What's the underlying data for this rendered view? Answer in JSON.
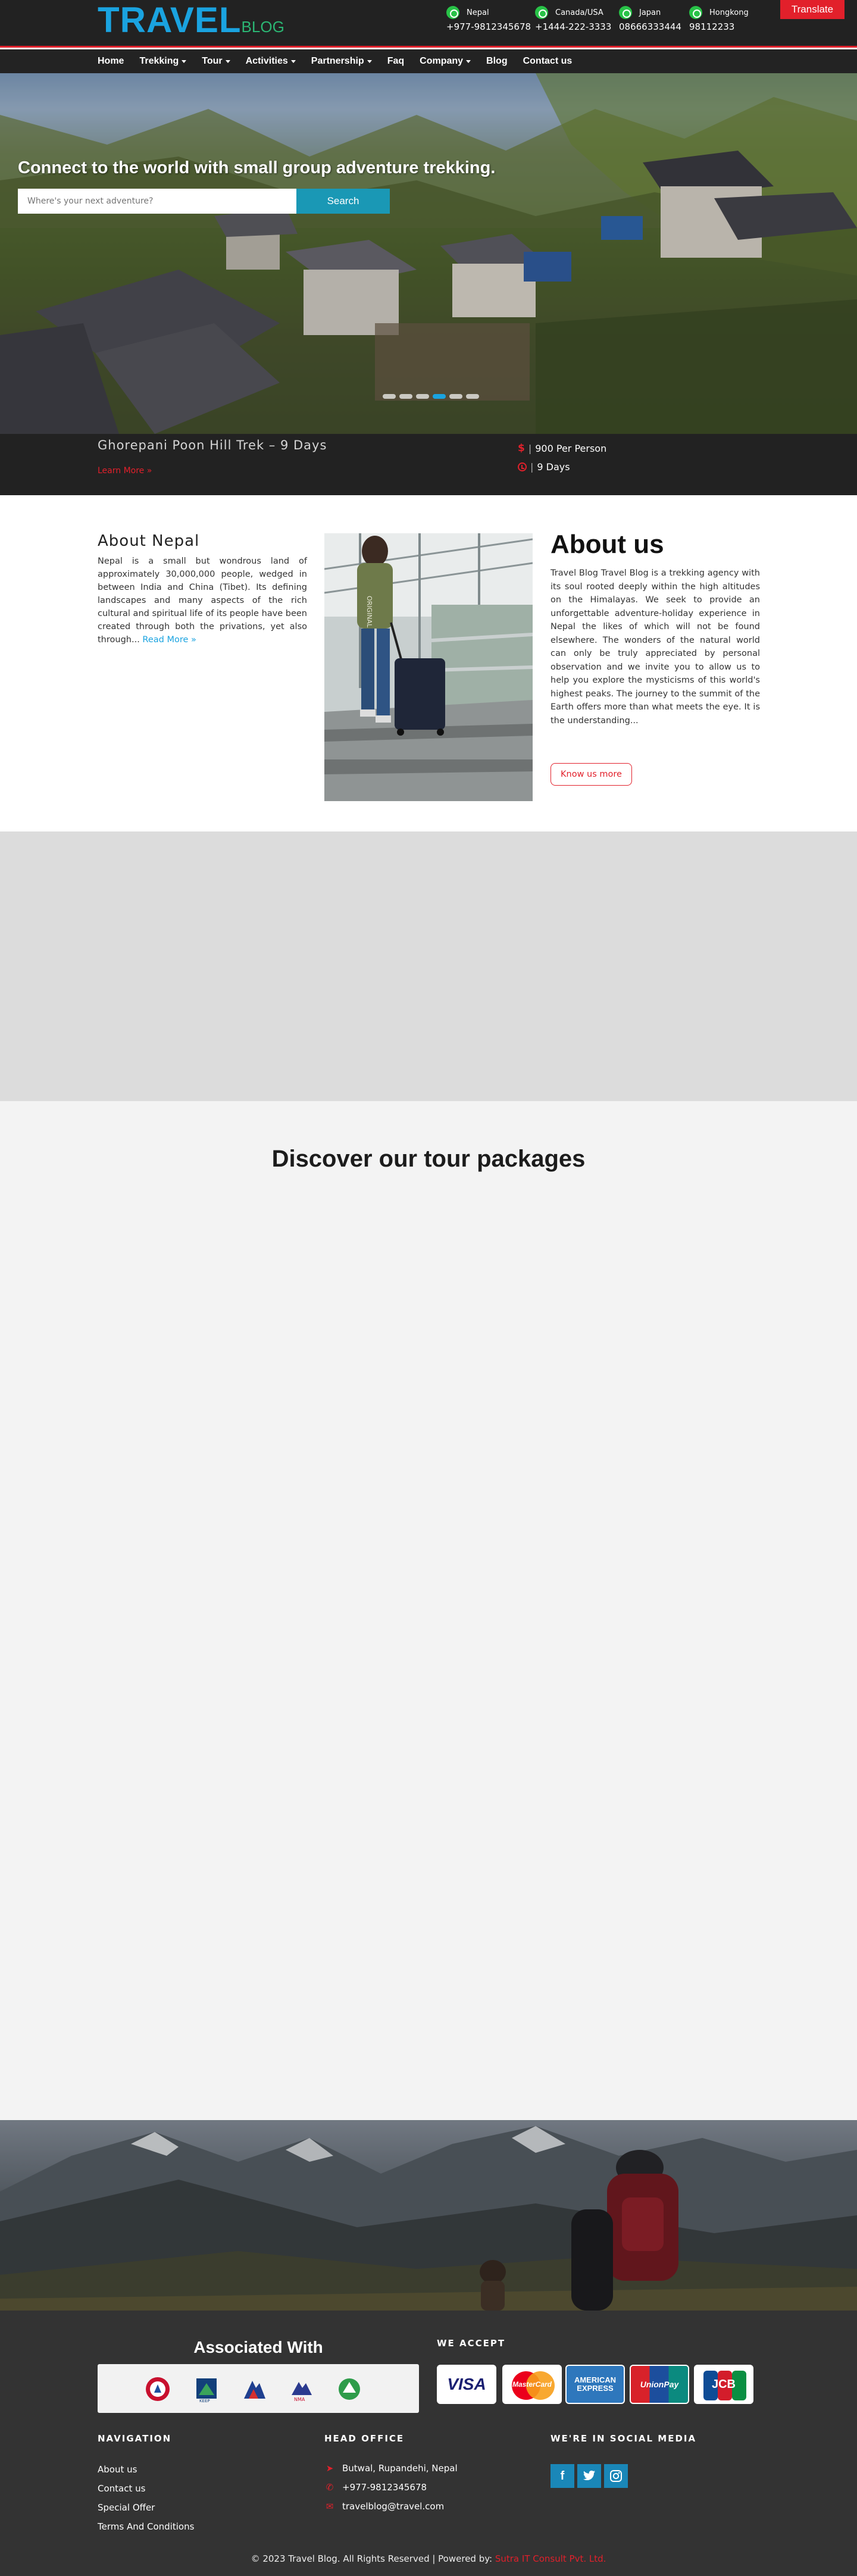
{
  "brand": {
    "logo_main": "TRAVEL",
    "logo_sub": "BLOG"
  },
  "contacts": [
    {
      "country": "Nepal",
      "number": "+977-9812345678"
    },
    {
      "country": "Canada/USA",
      "number": "+1444-222-3333"
    },
    {
      "country": "Japan",
      "number": "08666333444"
    },
    {
      "country": "Hongkong",
      "number": "98112233"
    }
  ],
  "translate_label": "Translate",
  "nav": {
    "items": [
      {
        "label": "Home",
        "dropdown": false
      },
      {
        "label": "Trekking",
        "dropdown": true
      },
      {
        "label": "Tour",
        "dropdown": true
      },
      {
        "label": "Activities",
        "dropdown": true
      },
      {
        "label": "Partnership",
        "dropdown": true
      },
      {
        "label": "Faq",
        "dropdown": false
      },
      {
        "label": "Company",
        "dropdown": true
      },
      {
        "label": "Blog",
        "dropdown": false
      },
      {
        "label": "Contact us",
        "dropdown": false
      }
    ]
  },
  "hero": {
    "title": "Connect to the world with small group adventure trekking.",
    "search_placeholder": "Where's your next adventure?",
    "search_button": "Search",
    "slide_count": 6,
    "active_slide": 4
  },
  "slide": {
    "trek_title": "Ghorepani Poon Hill Trek – 9 Days",
    "learn_more": "Learn More »",
    "price": "900 Per Person",
    "duration": "9 Days"
  },
  "about_nepal": {
    "heading": "About Nepal",
    "text": "Nepal is a small but wondrous land of approximately 30,000,000 people, wedged in between India and China (Tibet). Its defining landscapes and many aspects of the rich cultural and spiritual life of its people have been created through both the privations, yet also through...",
    "read_more": "Read More »"
  },
  "about_us": {
    "heading": "About us",
    "text": "Travel Blog Travel Blog is a trekking agency with its soul rooted deeply within the high altitudes on the Himalayas. We seek to provide an unforgettable adventure-holiday experience in Nepal the likes of which will not be found elsewhere. The wonders of the natural world can only be truly appreciated by personal observation and we invite you to allow us to help you explore the mysticisms of this world's highest peaks. The journey to the summit of the Earth offers more than what meets the eye. It is the understanding...",
    "button": "Know us more",
    "image_text": "ORIGINAL"
  },
  "packages": {
    "heading": "Discover our tour packages"
  },
  "footer": {
    "associated_heading": "Associated With",
    "we_accept_heading": "WE ACCEPT",
    "cards": [
      "VISA",
      "MasterCard",
      "AMERICAN EXPRESS",
      "UnionPay",
      "JCB"
    ],
    "assoc_logos": [
      "KEEP",
      "NMA"
    ],
    "navigation_heading": "NAVIGATION",
    "navigation_links": [
      "About us",
      "Contact us",
      "Special Offer",
      "Terms And Conditions"
    ],
    "office_heading": "HEAD OFFICE",
    "office": {
      "address": "Butwal, Rupandehi, Nepal",
      "phone": "+977-9812345678",
      "email": "travelblog@travel.com"
    },
    "social_heading": "WE'RE IN SOCIAL MEDIA",
    "social": [
      "f",
      "t",
      "ig"
    ],
    "copyright": "© 2023 Travel Blog. All Rights Reserved | Powered by:",
    "powered_by": "Sutra IT Consult Pvt. Ltd."
  },
  "colors": {
    "accent_red": "#e2202b",
    "brand_blue": "#1aa3e0",
    "whatsapp_green": "#28c247",
    "dark": "#222222"
  }
}
